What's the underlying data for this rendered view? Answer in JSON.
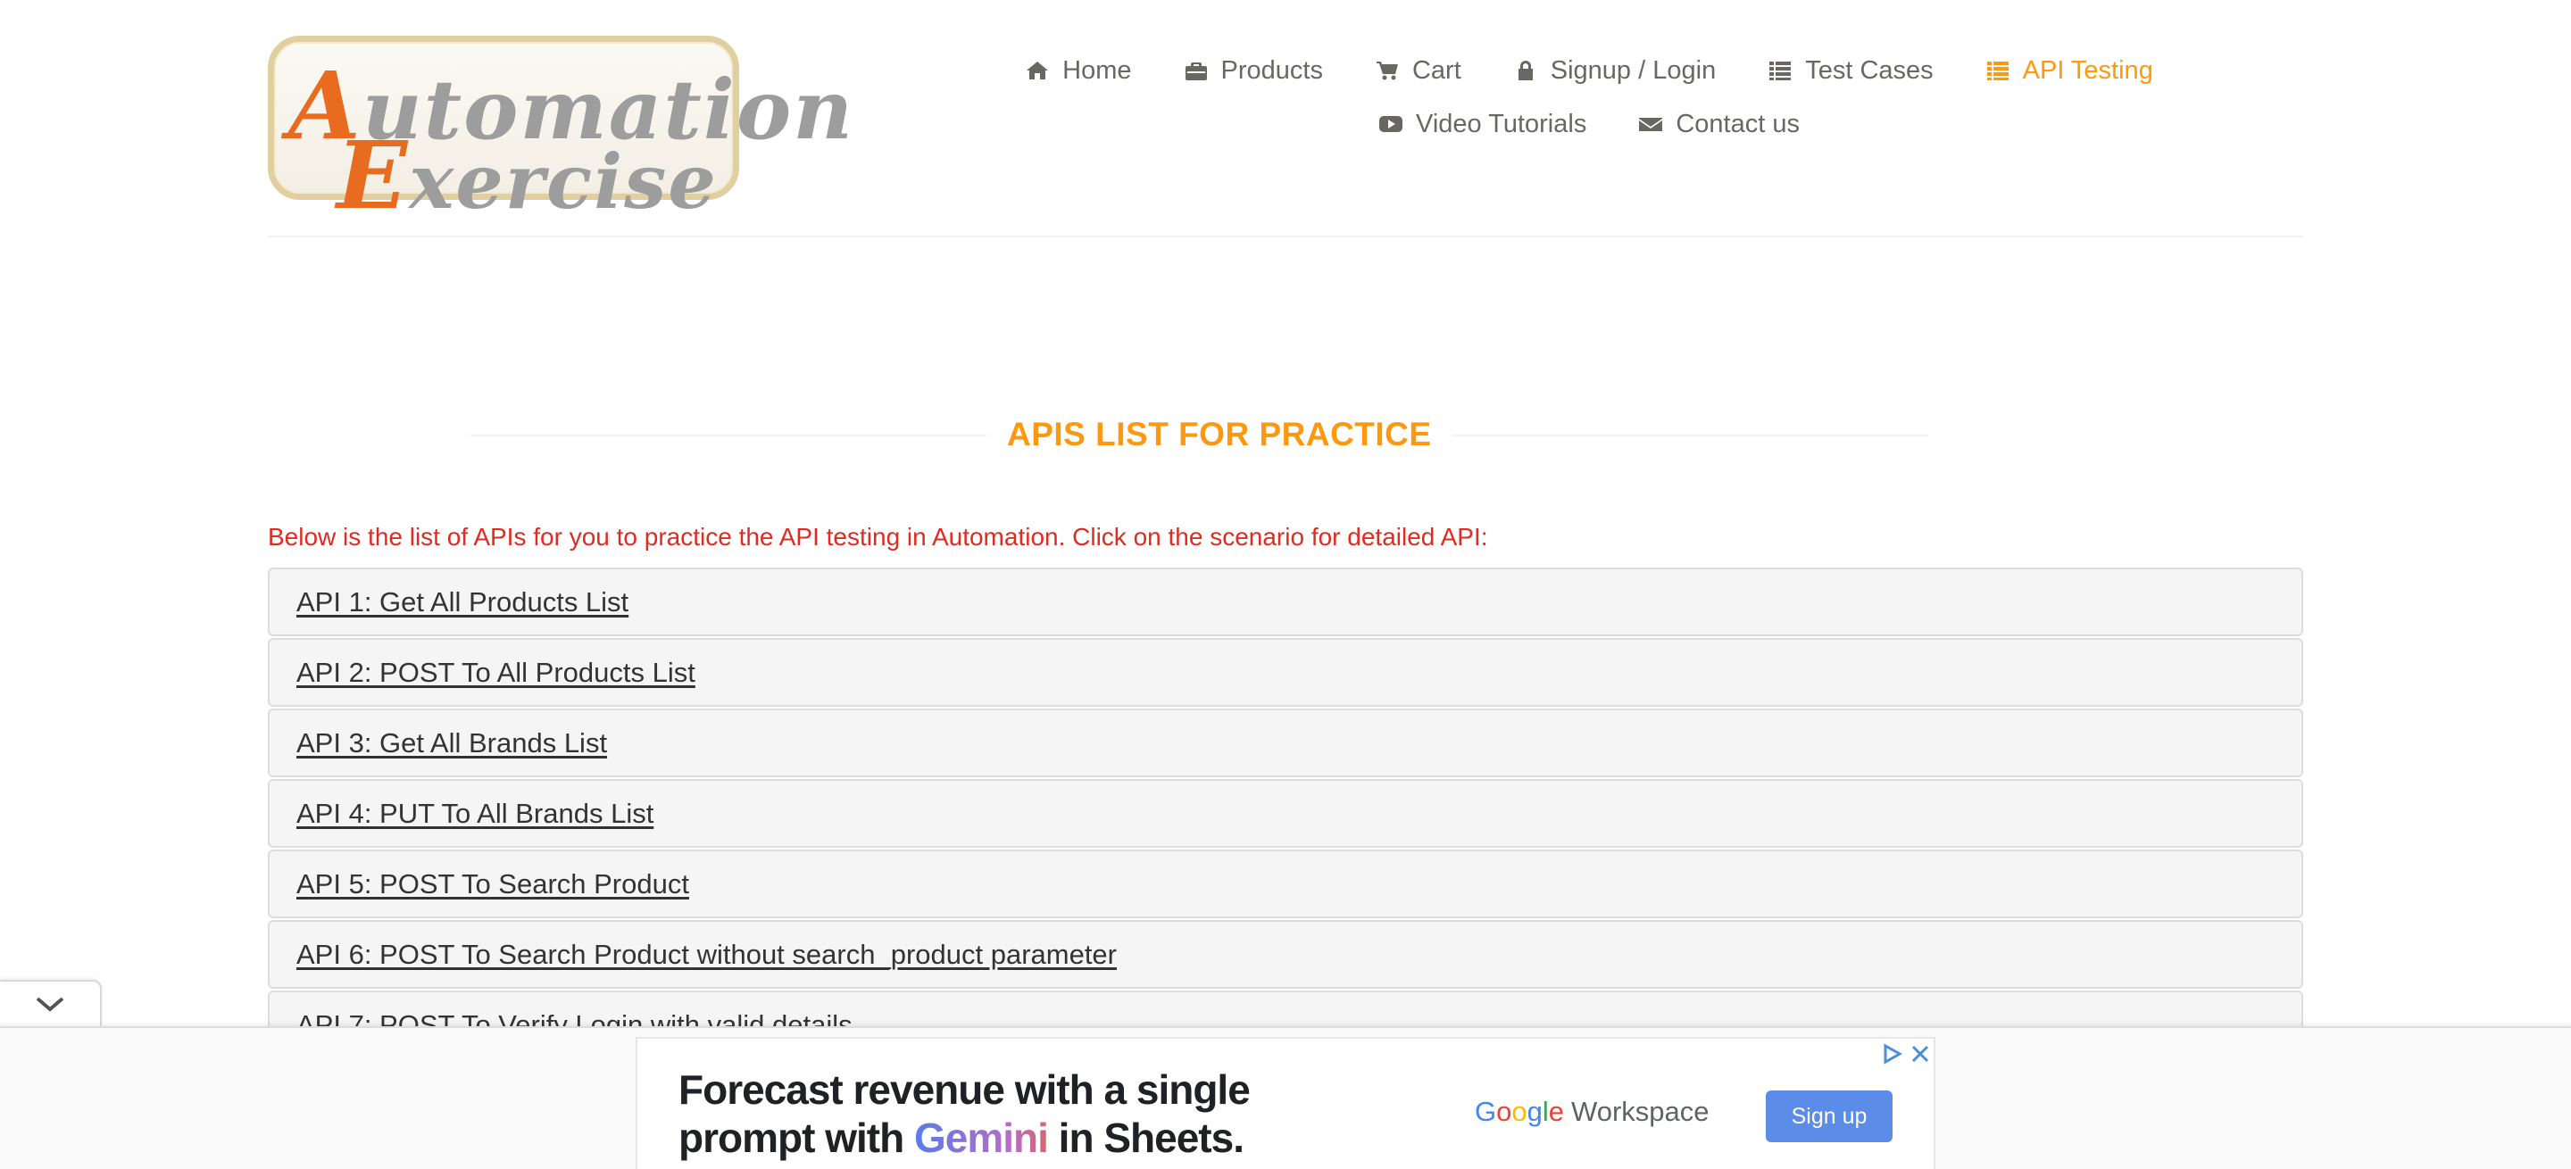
{
  "header": {
    "logo": {
      "line1_initial": "A",
      "line1_rest": "utomation",
      "line2_initial": "E",
      "line2_rest": "xercise"
    },
    "nav": {
      "row1": [
        {
          "label": "Home",
          "icon": "home-icon"
        },
        {
          "label": "Products",
          "icon": "briefcase-icon"
        },
        {
          "label": "Cart",
          "icon": "cart-icon"
        },
        {
          "label": "Signup / Login",
          "icon": "lock-icon"
        },
        {
          "label": "Test Cases",
          "icon": "list-icon"
        },
        {
          "label": "API Testing",
          "icon": "list-icon",
          "active": true
        }
      ],
      "row2": [
        {
          "label": "Video Tutorials",
          "icon": "youtube-icon"
        },
        {
          "label": "Contact us",
          "icon": "envelope-icon"
        }
      ]
    }
  },
  "main": {
    "title": "APIS LIST FOR PRACTICE",
    "intro": "Below is the list of APIs for you to practice the API testing in Automation. Click on the scenario for detailed API:",
    "apis": [
      "API 1: Get All Products List",
      "API 2: POST To All Products List",
      "API 3: Get All Brands List",
      "API 4: PUT To All Brands List",
      "API 5: POST To Search Product",
      "API 6: POST To Search Product without search_product parameter",
      "API 7: POST To Verify Login with valid details"
    ]
  },
  "ad": {
    "headline_line1": "Forecast revenue with a single",
    "headline_line2_pre": "prompt with ",
    "headline_line2_gemini": "Gemini",
    "headline_line2_post": " in Sheets.",
    "brand_g": "G",
    "brand_o1": "o",
    "brand_o2": "o",
    "brand_g2": "g",
    "brand_l": "l",
    "brand_e": "e",
    "brand_product": "Workspace",
    "cta": "Sign up"
  },
  "colors": {
    "accent": "#fe980f",
    "intro_text": "#e02b20",
    "nav_text": "#696763",
    "api_row_bg": "#f5f5f5",
    "ad_button": "#5b8de8"
  }
}
